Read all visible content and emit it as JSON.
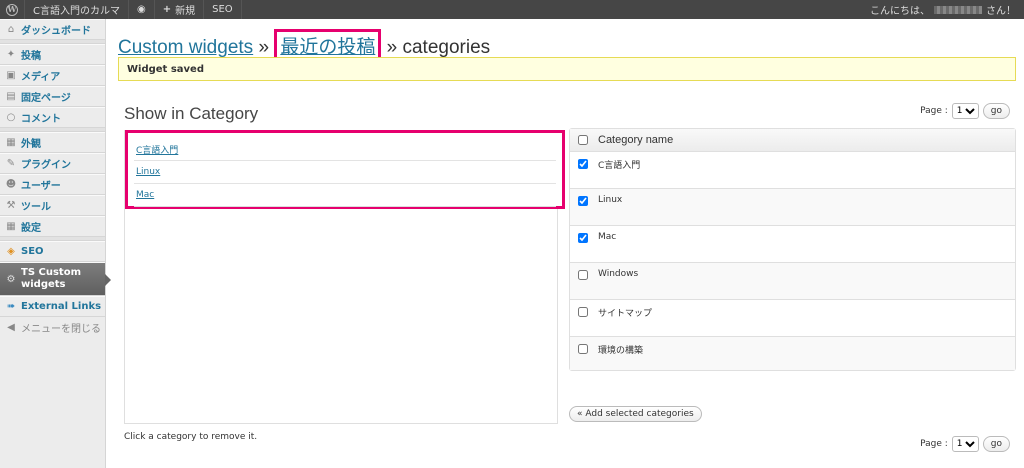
{
  "adminbar": {
    "site_name": "C言語入門のカルマ",
    "comment_icon": "comment-bubble-icon",
    "new_label": "新規",
    "seo_label": "SEO",
    "greeting_prefix": "こんにちは、",
    "greeting_suffix": "さん！"
  },
  "sidebar": {
    "items": [
      {
        "label": "ダッシュボード",
        "icon": "dashboard-icon"
      },
      {
        "label": "投稿",
        "icon": "pin-icon"
      },
      {
        "label": "メディア",
        "icon": "media-icon"
      },
      {
        "label": "固定ページ",
        "icon": "pages-icon"
      },
      {
        "label": "コメント",
        "icon": "comment-icon"
      },
      {
        "label": "外観",
        "icon": "appearance-icon"
      },
      {
        "label": "プラグイン",
        "icon": "plugin-icon"
      },
      {
        "label": "ユーザー",
        "icon": "users-icon"
      },
      {
        "label": "ツール",
        "icon": "tools-icon"
      },
      {
        "label": "設定",
        "icon": "settings-icon"
      },
      {
        "label": "SEO",
        "icon": "seo-icon"
      },
      {
        "label": "TS Custom widgets",
        "icon": "gear-icon"
      },
      {
        "label": "External Links",
        "icon": "external-links-icon"
      },
      {
        "label": "メニューを閉じる",
        "icon": "collapse-icon"
      }
    ]
  },
  "header": {
    "crumb1": "Custom widgets",
    "sep": "»",
    "crumb2": "最近の投稿",
    "crumb3": "categories"
  },
  "notice": "Widget saved",
  "section_title": "Show in Category",
  "pager": {
    "label": "Page :",
    "value": "1",
    "go": "go"
  },
  "selected_categories": [
    "C言語入門",
    "Linux",
    "Mac"
  ],
  "hint": "Click a category to remove it.",
  "category_table": {
    "header": "Category name",
    "rows": [
      {
        "name": "C言語入門",
        "checked": true
      },
      {
        "name": "Linux",
        "checked": true
      },
      {
        "name": "Mac",
        "checked": true
      },
      {
        "name": "Windows",
        "checked": false
      },
      {
        "name": "サイトマップ",
        "checked": false
      },
      {
        "name": "環境の構築",
        "checked": false
      }
    ]
  },
  "add_button": "« Add selected categories",
  "colors": {
    "link": "#21759b",
    "highlight": "#e6006e",
    "notice_bg": "#ffffe0"
  }
}
